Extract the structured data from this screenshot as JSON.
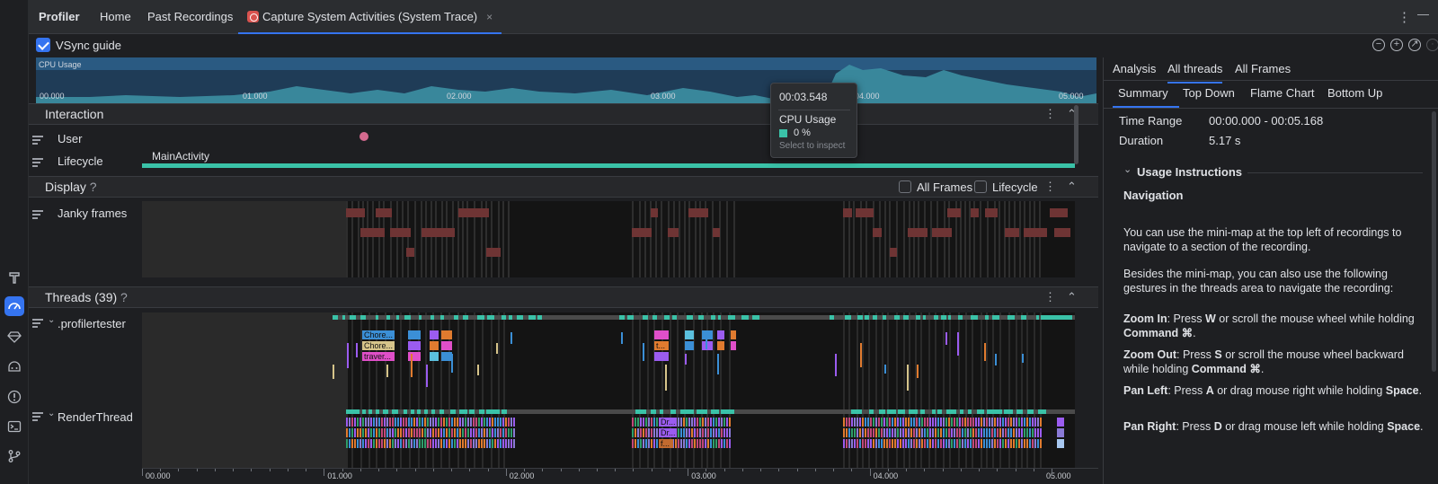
{
  "tabs": {
    "profiler": "Profiler",
    "home": "Home",
    "past_recordings": "Past Recordings",
    "capture": "Capture System Activities (System Trace)",
    "close": "×"
  },
  "toolbar": {
    "vsync_label": "VSync guide",
    "vsync_checked": true
  },
  "minimap": {
    "title": "CPU Usage",
    "ticks": [
      "00.000",
      "01.000",
      "02.000",
      "03.000",
      "04.000",
      "05.000"
    ]
  },
  "tooltip": {
    "time": "00:03.548",
    "metric": "CPU Usage",
    "value": "0 %",
    "hint": "Select to inspect"
  },
  "interaction": {
    "title": "Interaction",
    "rows": [
      "User",
      "Lifecycle"
    ],
    "activity": "MainActivity"
  },
  "display": {
    "title": "Display",
    "help": "?",
    "all_frames": "All Frames",
    "lifecycle": "Lifecycle",
    "janky": "Janky frames"
  },
  "threads": {
    "title": "Threads (39)",
    "help": "?",
    "thread1": ".profilertester",
    "thread2": "RenderThread",
    "slices1": [
      "Chore...",
      "Chore...",
      "traver...",
      "t..."
    ],
    "slices2": [
      "Dr...",
      "Dr...",
      "f..."
    ]
  },
  "axis": {
    "ticks": [
      "00.000",
      "01.000",
      "02.000",
      "03.000",
      "04.000",
      "05.000"
    ]
  },
  "right": {
    "tabs": [
      "Analysis",
      "All threads",
      "All Frames"
    ],
    "subtabs": [
      "Summary",
      "Top Down",
      "Flame Chart",
      "Bottom Up"
    ],
    "time_range_label": "Time Range",
    "time_range_value": "00:00.000 - 00:05.168",
    "duration_label": "Duration",
    "duration_value": "5.17 s",
    "usage_title": "Usage Instructions",
    "nav_title": "Navigation",
    "p1": "You can use the mini-map at the top left of recordings to navigate to a section of the recording.",
    "p2": "Besides the mini-map, you can also use the following gestures in the threads area to navigate the recording:",
    "zoom_in_label": "Zoom In",
    "zoom_in_text_a": ": Press ",
    "zoom_in_key": "W",
    "zoom_in_text_b": " or scroll the mouse wheel while holding ",
    "zoom_in_mod": "Command ⌘",
    "zoom_out_label": "Zoom Out",
    "zoom_out_text_a": ": Press ",
    "zoom_out_key": "S",
    "zoom_out_text_b": " or scroll the mouse wheel backward while holding ",
    "zoom_out_mod": "Command ⌘",
    "pan_left_label": "Pan Left",
    "pan_left_text_a": ": Press ",
    "pan_left_key": "A",
    "pan_left_text_b": " or drag mouse right while holding ",
    "pan_left_mod": "Space",
    "pan_right_label": "Pan Right",
    "pan_right_text_a": ": Press ",
    "pan_right_key": "D",
    "pan_right_text_b": " or drag mouse left while holding ",
    "pan_right_mod": "Space",
    "dot": "."
  },
  "colors": {
    "accent": "#3574f0",
    "teal": "#3ac2a8",
    "cpu_fill": "#3c8fa3",
    "janky": "#7a3737",
    "user_dot": "#d46a8f"
  }
}
